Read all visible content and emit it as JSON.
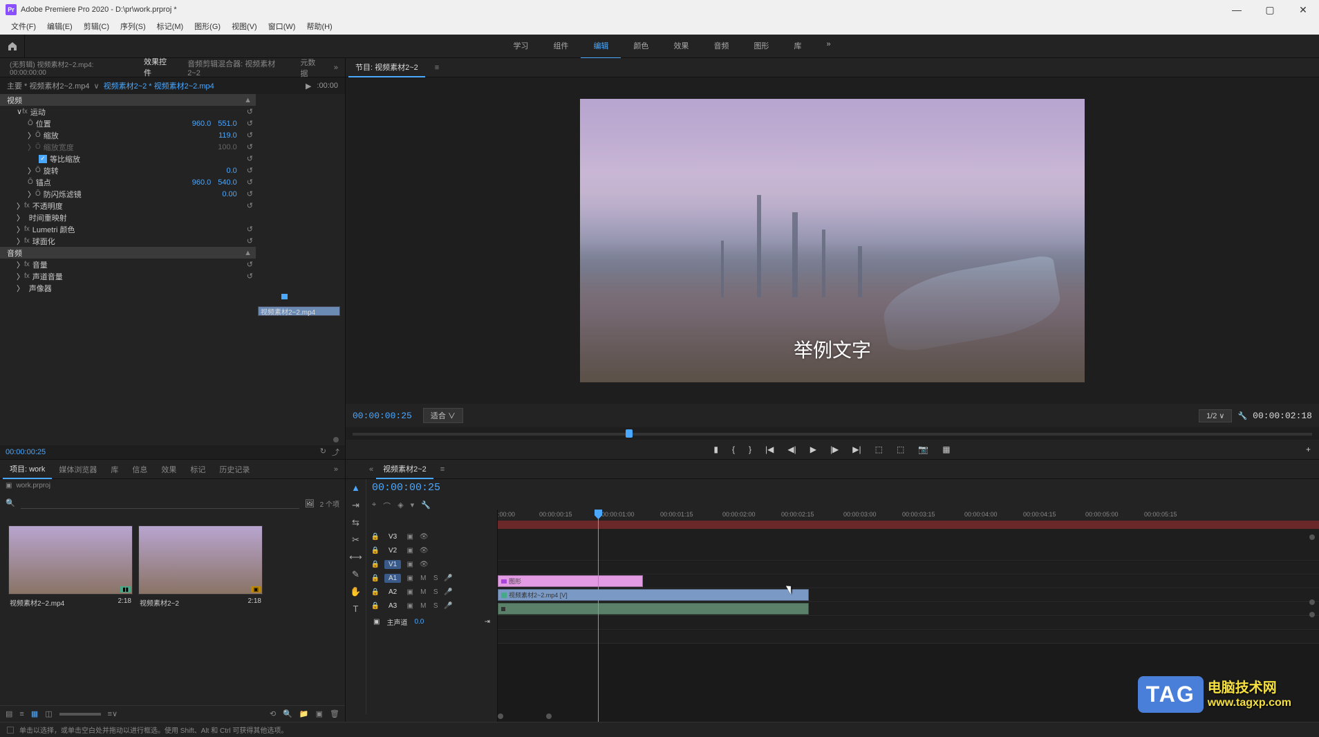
{
  "title": "Adobe Premiere Pro 2020 - D:\\pr\\work.prproj *",
  "menu": [
    "文件(F)",
    "编辑(E)",
    "剪辑(C)",
    "序列(S)",
    "标记(M)",
    "图形(G)",
    "视图(V)",
    "窗口(W)",
    "帮助(H)"
  ],
  "workspaces": [
    "学习",
    "组件",
    "编辑",
    "颜色",
    "效果",
    "音频",
    "图形",
    "库"
  ],
  "workspace_active": "编辑",
  "source_tabs": {
    "none": "(无剪辑) 视频素材2~2.mp4: 00:00:00:00",
    "active": "效果控件",
    "mixer": "音频剪辑混合器: 视频素材2~2",
    "meta": "元数据"
  },
  "source_title": {
    "master": "主要 * 视频素材2~2.mp4",
    "seq": "视频素材2~2 * 视频素材2~2.mp4",
    "tc": ":00:00"
  },
  "mini_clip": "视频素材2~2.mp4",
  "effects": {
    "video": "视频",
    "motion": "运动",
    "position": "位置",
    "pos_x": "960.0",
    "pos_y": "551.0",
    "scale": "缩放",
    "scale_v": "119.0",
    "scale_w": "缩放宽度",
    "scale_w_v": "100.0",
    "uniform": "等比缩放",
    "rotation": "旋转",
    "rot_v": "0.0",
    "anchor": "锚点",
    "anc_x": "960.0",
    "anc_y": "540.0",
    "flicker": "防闪烁滤镜",
    "flick_v": "0.00",
    "opacity": "不透明度",
    "timeremap": "时间重映射",
    "lumetri": "Lumetri 颜色",
    "spherize": "球面化",
    "audio": "音频",
    "volume": "音量",
    "chanvol": "声道音量",
    "panner": "声像器"
  },
  "src_tc": "00:00:00:25",
  "program_tab": "节目: 视频素材2~2",
  "sample_text": "举例文字",
  "monitor_tc": "00:00:00:25",
  "monitor_fit": "适合",
  "monitor_ratio": "1/2",
  "monitor_duration": "00:00:02:18",
  "project": {
    "tabs": [
      "项目: work",
      "媒体浏览器",
      "库",
      "信息",
      "效果",
      "标记",
      "历史记录"
    ],
    "tabs_active": "项目: work",
    "name": "work.prproj",
    "count": "2 个项",
    "items": [
      {
        "name": "视频素材2~2.mp4",
        "dur": "2:18"
      },
      {
        "name": "视频素材2~2",
        "dur": "2:18"
      }
    ]
  },
  "timeline": {
    "seq": "视频素材2~2",
    "tc": "00:00:00:25",
    "ruler": [
      ":00:00",
      "00:00:00:15",
      "00:00:01:00",
      "00:00:01:15",
      "00:00:02:00",
      "00:00:02:15",
      "00:00:03:00",
      "00:00:03:15",
      "00:00:04:00",
      "00:00:04:15",
      "00:00:05:00",
      "00:00:05:15"
    ],
    "tracks_v": [
      "V3",
      "V2",
      "V1"
    ],
    "tracks_a": [
      "A1",
      "A2",
      "A3"
    ],
    "master": "主声道",
    "master_v": "0.0",
    "clip_graphic": "图形",
    "clip_video": "视频素材2~2.mp4 [V]"
  },
  "status": "单击以选择，或单击空白处并拖动以进行框选。使用 Shift、Alt 和 Ctrl 可获得其他选项。",
  "watermark": {
    "tag": "TAG",
    "line1": "电脑技术网",
    "line2": "www.tagxp.com"
  }
}
